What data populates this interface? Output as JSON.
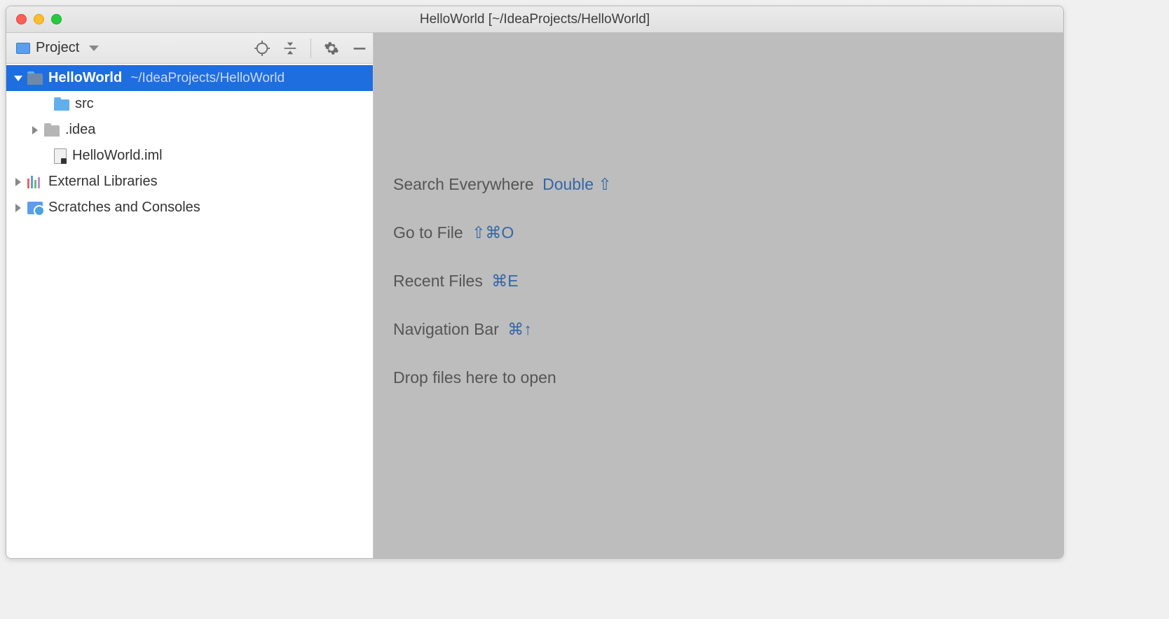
{
  "titlebar": {
    "title": "HelloWorld [~/IdeaProjects/HelloWorld]"
  },
  "sidebar": {
    "header": {
      "label": "Project"
    },
    "tree": {
      "root": {
        "name": "HelloWorld",
        "path": "~/IdeaProjects/HelloWorld"
      },
      "children": {
        "src": "src",
        "idea": ".idea",
        "iml": "HelloWorld.iml"
      },
      "external_libs": "External Libraries",
      "scratches": "Scratches and Consoles"
    }
  },
  "editor_hints": {
    "search_everywhere": {
      "label": "Search Everywhere",
      "keys": "Double ⇧"
    },
    "go_to_file": {
      "label": "Go to File",
      "keys": "⇧⌘O"
    },
    "recent_files": {
      "label": "Recent Files",
      "keys": "⌘E"
    },
    "navigation_bar": {
      "label": "Navigation Bar",
      "keys": "⌘↑"
    },
    "drop_files": "Drop files here to open"
  }
}
